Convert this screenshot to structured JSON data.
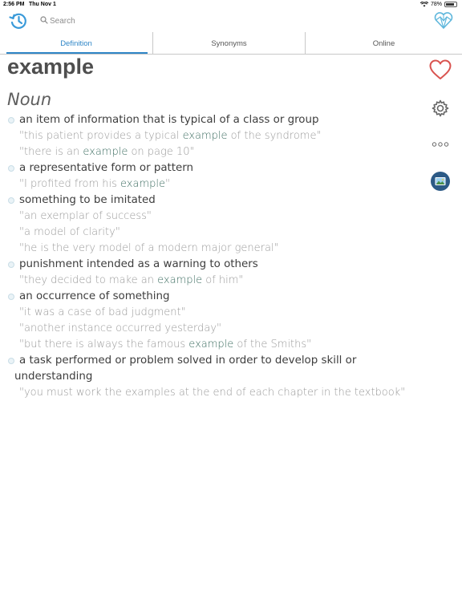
{
  "status": {
    "time": "2:56 PM",
    "date": "Thu Nov 1",
    "battery": "78%"
  },
  "search": {
    "placeholder": "Search"
  },
  "tabs": [
    {
      "label": "Definition",
      "active": true
    },
    {
      "label": "Synonyms",
      "active": false
    },
    {
      "label": "Online",
      "active": false
    }
  ],
  "word": "example",
  "part_of_speech": "Noun",
  "senses": [
    {
      "definition": "an item of information that is typical of a class or group",
      "examples": [
        [
          "\"this patient provides a typical ",
          "example",
          " of the syndrome\""
        ],
        [
          "\"there is an ",
          "example",
          " on page 10\""
        ]
      ]
    },
    {
      "definition": "a representative form or pattern",
      "examples": [
        [
          "\"I profited from his ",
          "example",
          "\""
        ]
      ]
    },
    {
      "definition": "something to be imitated",
      "examples": [
        [
          "\"an exemplar of success\"",
          "",
          ""
        ],
        [
          "\"a model of clarity\"",
          "",
          ""
        ],
        [
          "\"he is the very model of a modern major general\"",
          "",
          ""
        ]
      ]
    },
    {
      "definition": "punishment intended as a warning to others",
      "examples": [
        [
          "\"they decided to make an ",
          "example",
          " of him\""
        ]
      ]
    },
    {
      "definition": "an occurrence of something",
      "examples": [
        [
          "\"it was a case of bad judgment\"",
          "",
          ""
        ],
        [
          "\"another instance occurred yesterday\"",
          "",
          ""
        ],
        [
          "\"but there is always the famous ",
          "example",
          " of the Smiths\""
        ]
      ]
    },
    {
      "definition_lines": [
        "a task performed or problem solved in order to develop skill or",
        "understanding"
      ],
      "examples": [
        [
          "\"you must work the examples at the end of each chapter in the textbook\"",
          "",
          ""
        ]
      ]
    }
  ],
  "colors": {
    "accent": "#2f86c7",
    "favorite": "#d9534f",
    "highlight": "#3e6e62"
  },
  "icons": [
    "history-icon",
    "search-icon",
    "heart-logo-icon",
    "favorite-heart-icon",
    "settings-gear-icon",
    "more-icon",
    "image-icon"
  ]
}
